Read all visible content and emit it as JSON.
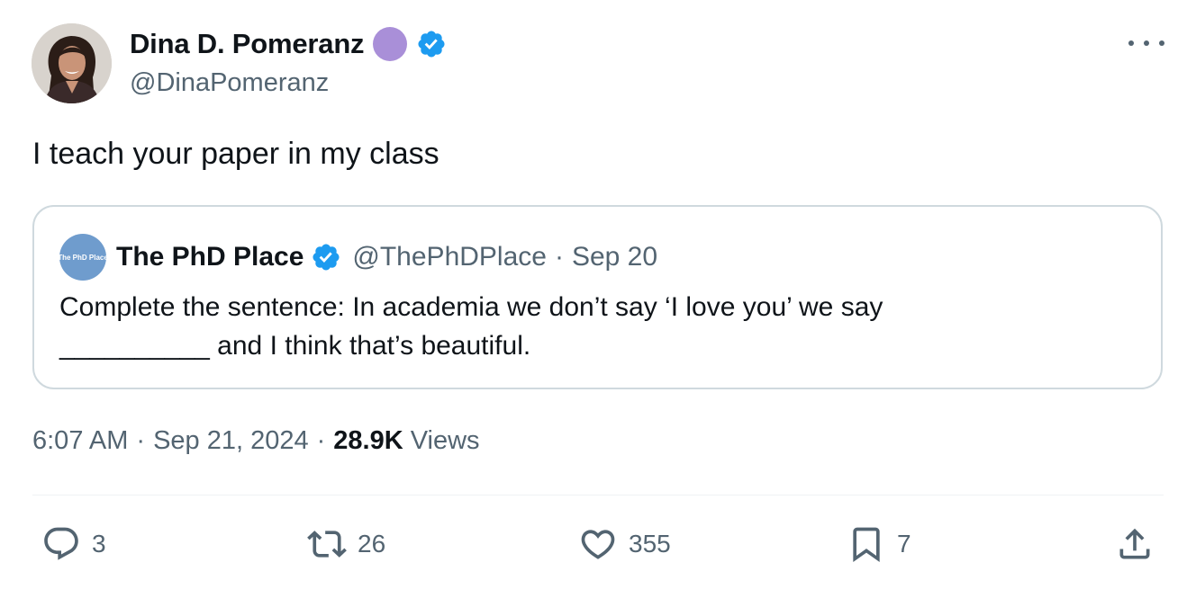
{
  "author": {
    "display_name": "Dina D. Pomeranz",
    "handle": "@DinaPomeranz",
    "avatar_icon": "profile-photo",
    "badge_color": "#a98fd8",
    "verified_color": "#1d9bf0"
  },
  "tweet": {
    "text": "I teach your paper in my class",
    "time": "6:07 AM",
    "date": "Sep 21, 2024",
    "views_count": "28.9K",
    "views_label": "Views"
  },
  "quote": {
    "avatar_text": "The PhD Place",
    "display_name": "The PhD Place",
    "handle": "@ThePhDPlace",
    "separator": "·",
    "date": "Sep 20",
    "text_line1": "Complete the sentence: In academia we don’t say ‘I love you’ we say",
    "text_line2": "__________ and I think that’s beautiful."
  },
  "meta": {
    "separator": "·"
  },
  "actions": {
    "reply_count": "3",
    "retweet_count": "26",
    "like_count": "355",
    "bookmark_count": "7",
    "icon_color": "#536471"
  }
}
